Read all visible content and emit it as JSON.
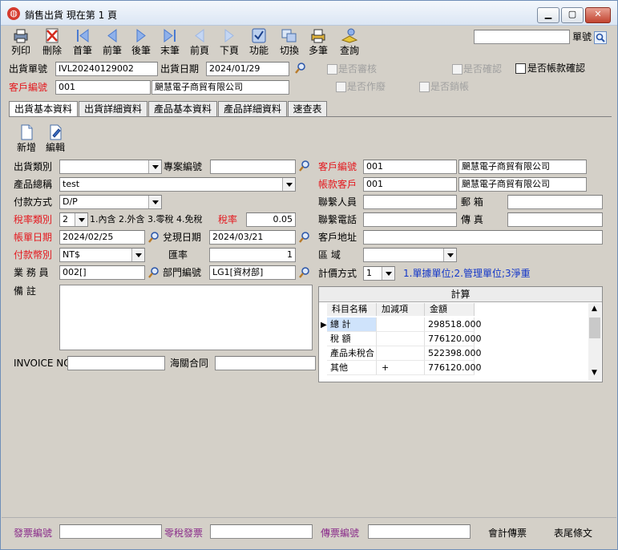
{
  "window": {
    "title": "銷售出貨  現在第 1 頁",
    "app_icon": "globe-icon"
  },
  "toolbar": [
    {
      "label": "列印",
      "icon": "printer-icon"
    },
    {
      "label": "刪除",
      "icon": "delete-icon"
    },
    {
      "label": "首筆",
      "icon": "first-icon"
    },
    {
      "label": "前筆",
      "icon": "prev-icon"
    },
    {
      "label": "後筆",
      "icon": "next-icon"
    },
    {
      "label": "末筆",
      "icon": "last-icon"
    },
    {
      "label": "前頁",
      "icon": "prev-page-icon"
    },
    {
      "label": "下頁",
      "icon": "next-page-icon"
    },
    {
      "label": "功能",
      "icon": "function-icon"
    },
    {
      "label": "切換",
      "icon": "switch-icon"
    },
    {
      "label": "多筆",
      "icon": "multi-icon"
    },
    {
      "label": "查詢",
      "icon": "query-icon"
    }
  ],
  "search": {
    "value": "",
    "label": "單號"
  },
  "header": {
    "order_no_label": "出貨單號",
    "order_no": "IVL20240129002",
    "ship_date_label": "出貨日期",
    "ship_date": "2024/01/29",
    "customer_no_label": "客戶編號",
    "customer_no": "001",
    "customer_name": "颶慧電子商貿有限公司",
    "reviewed_label": "是否審核",
    "confirmed_label": "是否確認",
    "account_confirmed_label": "是否帳款確認",
    "void_label": "是否作廢",
    "sold_label": "是否銷帳"
  },
  "tabs": [
    "出貨基本資料",
    "出貨詳細資料",
    "產品基本資料",
    "產品詳細資料",
    "速查表"
  ],
  "actions": [
    {
      "label": "新增",
      "icon": "new-icon"
    },
    {
      "label": "編輯",
      "icon": "edit-icon"
    }
  ],
  "form": {
    "ship_type_label": "出貨類別",
    "ship_type": "",
    "project_no_label": "專案編號",
    "project_no": "",
    "product_category_label": "產品總稱",
    "product_category": "test",
    "payment_label": "付款方式",
    "payment": "D/P",
    "tax_type_label": "稅率類別",
    "tax_type": "2",
    "tax_type_hint": "1.內含 2.外含 3.零稅 4.免稅",
    "tax_rate_label": "稅率",
    "tax_rate": "0.05",
    "bill_date_label": "帳單日期",
    "bill_date": "2024/02/25",
    "cash_date_label": "兌現日期",
    "cash_date": "2024/03/21",
    "currency_label": "付款幣別",
    "currency": "NT$",
    "exchange_label": "匯率",
    "exchange": "1",
    "sales_label": "業  務  員",
    "sales": "002[]",
    "dept_label": "部門編號",
    "dept": "LG1[資材部]",
    "remark_label": "備    註",
    "invoice_label": "INVOICE NO.",
    "invoice": "",
    "customs_label": "海關合同",
    "customs": "",
    "customer_no_label": "客戶編號",
    "customer_no": "001",
    "customer_name": "颶慧電子商貿有限公司",
    "account_customer_label": "帳款客戶",
    "account_customer_no": "001",
    "account_customer_name": "颶慧電子商貿有限公司",
    "contact_label": "聯繫人員",
    "contact": "",
    "mailbox_label": "郵      箱",
    "mailbox": "",
    "phone_label": "聯繫電話",
    "phone": "",
    "fax_label": "傳      真",
    "fax": "",
    "address_label": "客戶地址",
    "address": "",
    "region_label": "區      域",
    "region": "",
    "pricing_label": "計價方式",
    "pricing": "1",
    "pricing_hint": "1.單據單位;2.管理單位;3淨重"
  },
  "calc": {
    "title": "計算",
    "columns": [
      "科目名稱",
      "加減項",
      "金額"
    ],
    "rows": [
      {
        "name": "總      計",
        "op": "",
        "amount": "298518.000"
      },
      {
        "name": "稅      額",
        "op": "",
        "amount": "776120.000"
      },
      {
        "name": "產品未稅合",
        "op": "",
        "amount": "522398.000"
      },
      {
        "name": "其他",
        "op": "+",
        "amount": "776120.000"
      }
    ]
  },
  "footer": {
    "invoice_no_label": "發票編號",
    "invoice_no": "",
    "zero_tax_label": "零稅發票",
    "zero_tax": "",
    "fax_no_label": "傳票編號",
    "fax_no": "",
    "accounting_label": "會計傳票",
    "tail_label": "表尾條文"
  },
  "colors": {
    "red": "#e4171d",
    "purple": "#8a2b8a",
    "blue": "#1336c8",
    "bg": "#d4d0c8"
  }
}
